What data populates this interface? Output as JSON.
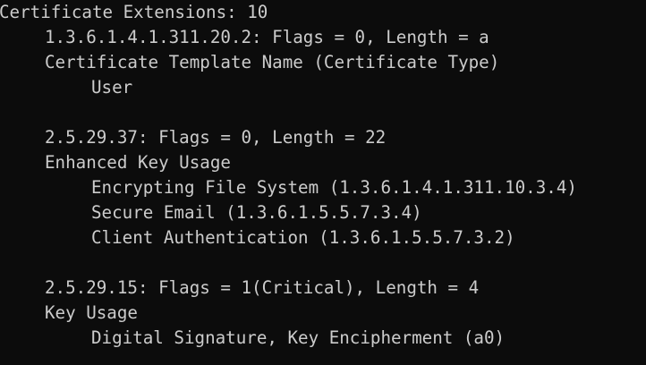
{
  "console": {
    "header": "Certificate Extensions: 10",
    "extensions": [
      {
        "oid_line": "1.3.6.1.4.1.311.20.2: Flags = 0, Length = a",
        "name": "Certificate Template Name (Certificate Type)",
        "values": [
          "User"
        ]
      },
      {
        "oid_line": "2.5.29.37: Flags = 0, Length = 22",
        "name": "Enhanced Key Usage",
        "values": [
          "Encrypting File System (1.3.6.1.4.1.311.10.3.4)",
          "Secure Email (1.3.6.1.5.5.7.3.4)",
          "Client Authentication (1.3.6.1.5.5.7.3.2)"
        ]
      },
      {
        "oid_line": "2.5.29.15: Flags = 1(Critical), Length = 4",
        "name": "Key Usage",
        "values": [
          "Digital Signature, Key Encipherment (a0)"
        ]
      }
    ],
    "colors": {
      "background": "#0c0c0c",
      "foreground": "#cccccc"
    }
  }
}
